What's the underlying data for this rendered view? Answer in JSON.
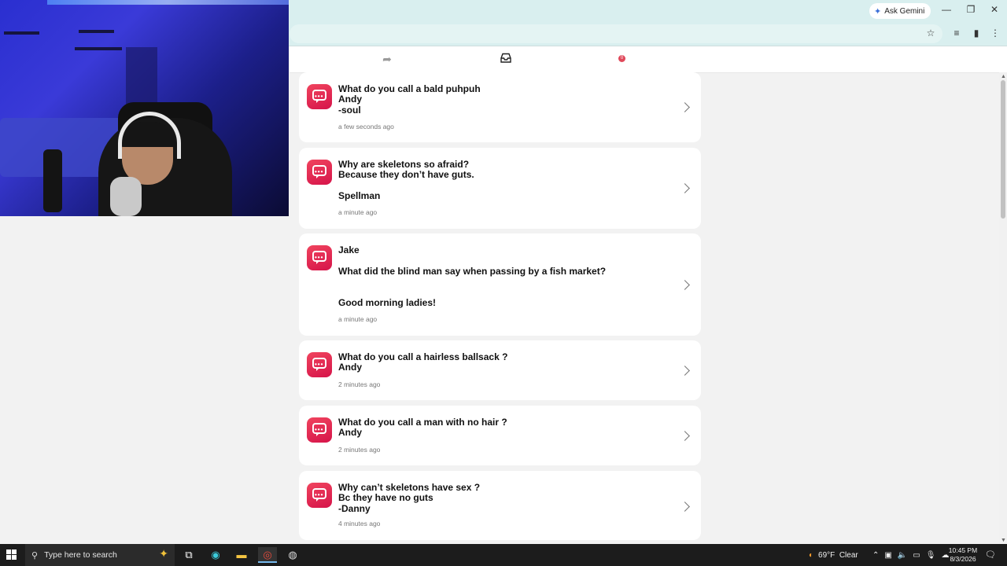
{
  "browser": {
    "ask_gemini": "Ask Gemini",
    "minimize": "—",
    "restore": "❐",
    "close": "✕"
  },
  "feed": [
    {
      "message": "What do you call a bald puhpuh\nAndy\n-soul",
      "time": "a few seconds ago"
    },
    {
      "message": "Why are skeletons so afraid?\n Because they don’t have guts.\n\nSpellman",
      "time": "a minute ago"
    },
    {
      "message": "Jake\n\nWhat did the blind man say when passing by a fish market?\n\n\nGood morning ladies!",
      "time": "a minute ago"
    },
    {
      "message": "What do you call a hairless ballsack ?\nAndy",
      "time": "2 minutes ago"
    },
    {
      "message": "What do you call a man with no hair ?\nAndy",
      "time": "2 minutes ago"
    },
    {
      "message": "Why can’t skeletons have sex ?\nBc they have no guts\n-Danny",
      "time": "4 minutes ago"
    }
  ],
  "nav": {
    "badge_count": "0"
  },
  "taskbar": {
    "search_placeholder": "Type here to search",
    "weather": "69°F  Clear",
    "time": "10:45 PM",
    "date": "8/3/2026"
  },
  "colors": {
    "accent": "#e0284f",
    "browser_bar": "#d9efef"
  }
}
